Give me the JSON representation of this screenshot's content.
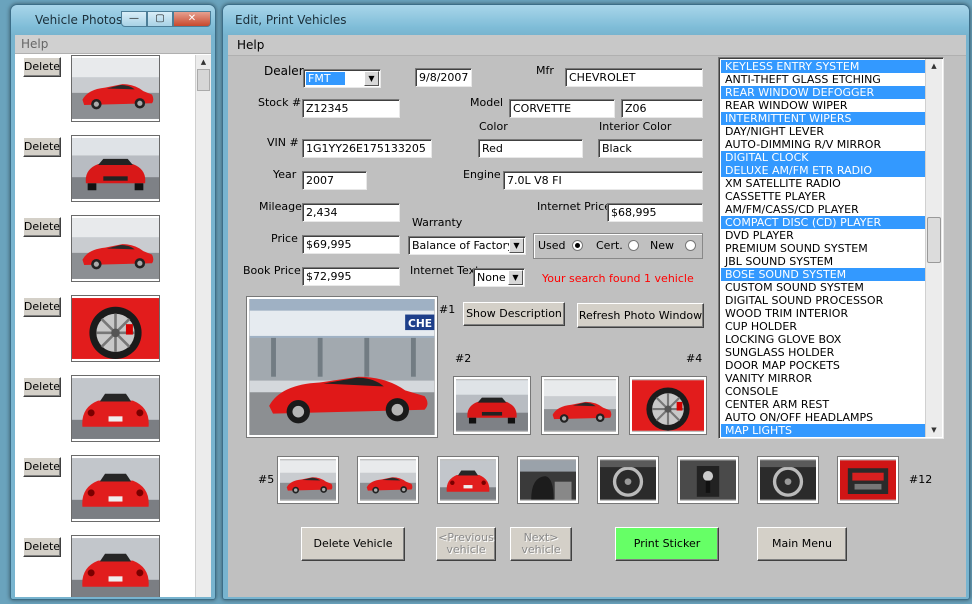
{
  "photos_window": {
    "title": "Vehicle Photos",
    "controls": {
      "minimize": "—",
      "restore": "▢",
      "close": "✕"
    },
    "menu": [
      "Help"
    ],
    "delete_label": "Delete",
    "photo_count": 7
  },
  "edit_window": {
    "title": "Edit, Print Vehicles",
    "menu": [
      "Help"
    ],
    "form": {
      "dealer_label": "Dealer",
      "dealer": "FMT",
      "date": "9/8/2007",
      "mfr_label": "Mfr",
      "mfr": "CHEVROLET",
      "stock_label": "Stock #",
      "stock": "Z12345",
      "model_label": "Model",
      "model": "CORVETTE",
      "trim": "Z06",
      "color_label": "Color",
      "color": "Red",
      "interior_label": "Interior Color",
      "interior": "Black",
      "vin_label": "VIN #",
      "vin": "1G1YY26E175133205",
      "year_label": "Year",
      "year": "2007",
      "engine_label": "Engine",
      "engine": "7.0L V8 FI",
      "mileage_label": "Mileage",
      "mileage": "2,434",
      "warranty_label": "Warranty",
      "warranty": "Balance of Factory",
      "internet_price_label": "Internet Price",
      "internet_price": "$68,995",
      "price_label": "Price",
      "price": "$69,995",
      "book_price_label": "Book Price",
      "book_price": "$72,995",
      "internet_text_label": "Internet Text",
      "internet_text": "None",
      "condition_used": "Used",
      "condition_cert": "Cert.",
      "condition_new": "New",
      "search_result": "Your search found 1 vehicle"
    },
    "buttons": {
      "show_description": "Show Description",
      "refresh_photo": "Refresh Photo Window",
      "delete_vehicle": "Delete Vehicle",
      "previous": "<Previous\nvehicle",
      "next": "Next>\nvehicle",
      "print_sticker": "Print Sticker",
      "main_menu": "Main Menu"
    },
    "photo_labels": {
      "p1": "#1",
      "p2": "#2",
      "p4": "#4",
      "p5": "#5",
      "p12": "#12"
    },
    "options": [
      {
        "text": "KEYLESS ENTRY SYSTEM",
        "selected": true
      },
      {
        "text": "ANTI-THEFT GLASS ETCHING",
        "selected": false
      },
      {
        "text": "REAR WINDOW DEFOGGER",
        "selected": true
      },
      {
        "text": "REAR WINDOW WIPER",
        "selected": false
      },
      {
        "text": "INTERMITTENT WIPERS",
        "selected": true
      },
      {
        "text": "DAY/NIGHT LEVER",
        "selected": false
      },
      {
        "text": "AUTO-DIMMING R/V MIRROR",
        "selected": false
      },
      {
        "text": "DIGITAL CLOCK",
        "selected": true
      },
      {
        "text": "DELUXE AM/FM ETR RADIO",
        "selected": true
      },
      {
        "text": "XM SATELLITE RADIO",
        "selected": false
      },
      {
        "text": "CASSETTE PLAYER",
        "selected": false
      },
      {
        "text": "AM/FM/CASS/CD PLAYER",
        "selected": false
      },
      {
        "text": "COMPACT DISC (CD) PLAYER",
        "selected": true
      },
      {
        "text": "DVD PLAYER",
        "selected": false
      },
      {
        "text": "PREMIUM SOUND SYSTEM",
        "selected": false
      },
      {
        "text": "JBL SOUND SYSTEM",
        "selected": false
      },
      {
        "text": "BOSE SOUND SYSTEM",
        "selected": true
      },
      {
        "text": "CUSTOM SOUND SYSTEM",
        "selected": false
      },
      {
        "text": "DIGITAL SOUND PROCESSOR",
        "selected": false
      },
      {
        "text": "WOOD TRIM INTERIOR",
        "selected": false
      },
      {
        "text": "CUP HOLDER",
        "selected": false
      },
      {
        "text": "LOCKING GLOVE BOX",
        "selected": false
      },
      {
        "text": "SUNGLASS HOLDER",
        "selected": false
      },
      {
        "text": "DOOR MAP POCKETS",
        "selected": false
      },
      {
        "text": "VANITY MIRROR",
        "selected": false
      },
      {
        "text": "CONSOLE",
        "selected": false
      },
      {
        "text": "CENTER ARM REST",
        "selected": false
      },
      {
        "text": "AUTO ON/OFF HEADLAMPS",
        "selected": false
      },
      {
        "text": "MAP LIGHTS",
        "selected": true
      }
    ],
    "colors": {
      "selection": "#3399ff",
      "print_button": "#66ff66",
      "result_text": "#ff0000"
    }
  }
}
